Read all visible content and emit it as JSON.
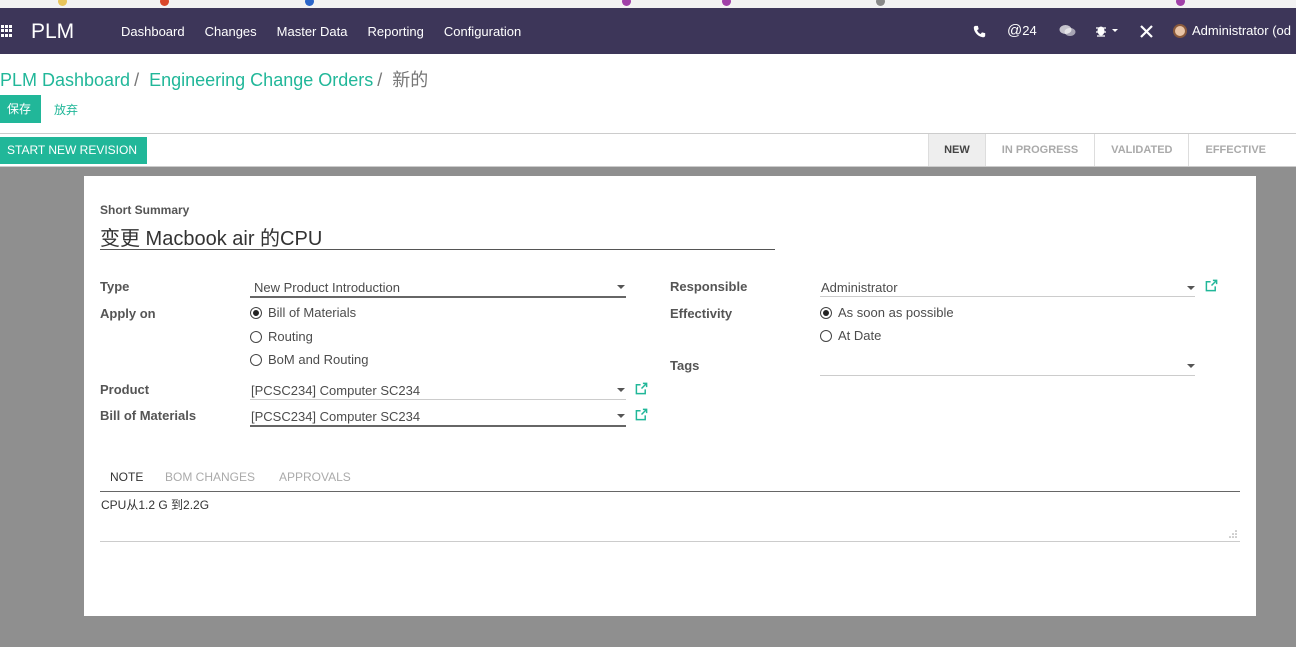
{
  "navbar": {
    "brand": "PLM",
    "menu": [
      "Dashboard",
      "Changes",
      "Master Data",
      "Reporting",
      "Configuration"
    ],
    "message_count": "24",
    "user": "Administrator (od"
  },
  "breadcrumb": {
    "items": [
      "PLM Dashboard",
      "Engineering Change Orders"
    ],
    "current": "新的"
  },
  "actions": {
    "save_label": "保存",
    "discard_label": "放弃",
    "revision_label": "START NEW REVISION"
  },
  "stages": [
    "NEW",
    "IN PROGRESS",
    "VALIDATED",
    "EFFECTIVE"
  ],
  "form": {
    "short_summary_label": "Short Summary",
    "short_summary_value": "变更 Macbook air 的CPU",
    "type_label": "Type",
    "type_value": "New Product Introduction",
    "apply_on_label": "Apply on",
    "apply_on_options": [
      "Bill of Materials",
      "Routing",
      "BoM and Routing"
    ],
    "product_label": "Product",
    "product_value": "[PCSC234] Computer SC234",
    "bom_label": "Bill of Materials",
    "bom_value": "[PCSC234] Computer SC234",
    "responsible_label": "Responsible",
    "responsible_value": "Administrator",
    "effectivity_label": "Effectivity",
    "effectivity_options": [
      "As soon as possible",
      "At Date"
    ],
    "tags_label": "Tags"
  },
  "tabs": [
    "NOTE",
    "BOM CHANGES",
    "APPROVALS"
  ],
  "note_text": "CPU从1.2 G 到2.2G",
  "colors": {
    "navbar": "#3d3659",
    "accent": "#21b799"
  }
}
